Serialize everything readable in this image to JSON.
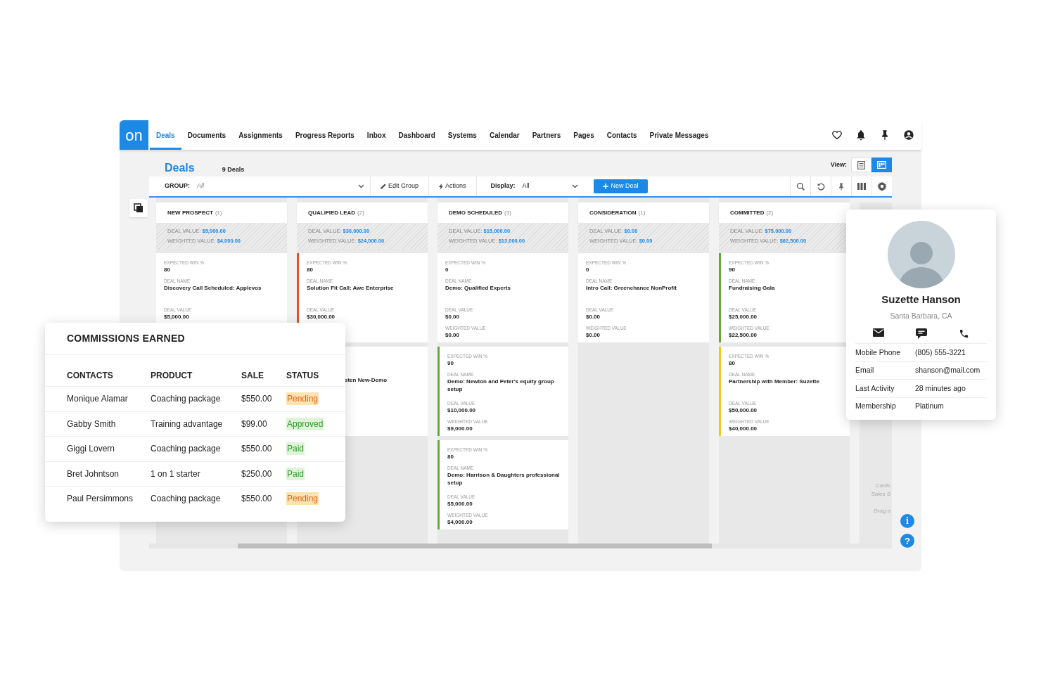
{
  "nav": {
    "logo": "on",
    "items": [
      {
        "label": "Deals",
        "selected": true
      },
      {
        "label": "Documents",
        "selected": false
      },
      {
        "label": "Assignments",
        "selected": false
      },
      {
        "label": "Progress Reports",
        "selected": false
      },
      {
        "label": "Inbox",
        "selected": false
      },
      {
        "label": "Dashboard",
        "selected": false
      },
      {
        "label": "Systems",
        "selected": false
      },
      {
        "label": "Calendar",
        "selected": false
      },
      {
        "label": "Partners",
        "selected": false
      },
      {
        "label": "Pages",
        "selected": false
      },
      {
        "label": "Contacts",
        "selected": false
      },
      {
        "label": "Private Messages",
        "selected": false
      }
    ]
  },
  "header": {
    "title": "Deals",
    "count": "9 Deals",
    "view_label": "View:",
    "views": [
      {
        "kind": "list",
        "selected": false
      },
      {
        "kind": "board",
        "selected": true
      }
    ]
  },
  "toolbar": {
    "group_label": "GROUP:",
    "group_placeholder": "All",
    "edit_group": "Edit Group",
    "actions": "Actions",
    "display_label": "Display:",
    "display_value": "All",
    "new_deal": "New Deal"
  },
  "columns": [
    {
      "title": "NEW PROSPECT",
      "count": "(1)",
      "deal_value_label": "DEAL VALUE:",
      "deal_value": "$5,000.00",
      "weighted_label": "WEIGHTED VALUE:",
      "weighted_value": "$4,000.00",
      "cards": [
        {
          "kind": "deal",
          "fields": [
            {
              "label": "EXPECTED WIN %",
              "value": "80"
            },
            {
              "label": "DEAL NAME",
              "value": "Discovery Call Scheduled: Applevos"
            },
            {
              "label": "DEAL VALUE",
              "value": "$5,000.00"
            }
          ]
        }
      ]
    },
    {
      "title": "QUALIFIED LEAD",
      "count": "(2)",
      "deal_value_label": "DEAL VALUE:",
      "deal_value": "$30,000.00",
      "weighted_label": "WEIGHTED VALUE:",
      "weighted_value": "$24,000.00",
      "cards": [
        {
          "kind": "deal",
          "color": "#e4521e",
          "fields": [
            {
              "label": "EXPECTED WIN %",
              "value": "80"
            },
            {
              "label": "DEAL NAME",
              "value": "Solution Fit Call: Awe Enterprise"
            },
            {
              "label": "DEAL VALUE",
              "value": "$30,000.00"
            }
          ]
        },
        {
          "kind": "covered",
          "fields": [
            {
              "value": "sten New-Demo"
            }
          ]
        }
      ]
    },
    {
      "title": "DEMO SCHEDULED",
      "count": "(3)",
      "deal_value_label": "DEAL VALUE:",
      "deal_value": "$15,000.00",
      "weighted_label": "WEIGHTED VALUE:",
      "weighted_value": "$13,000.00",
      "cards": [
        {
          "kind": "deal",
          "fields": [
            {
              "label": "EXPECTED WIN %",
              "value": "0"
            },
            {
              "label": "DEAL NAME",
              "value": "Demo: Qualified Experts"
            },
            {
              "label": "DEAL VALUE",
              "value": "$0.00"
            },
            {
              "label": "WEIGHTED VALUE",
              "value": "$0.00"
            }
          ]
        },
        {
          "kind": "deal",
          "color": "#65a83a",
          "fields": [
            {
              "label": "EXPECTED WIN %",
              "value": "90"
            },
            {
              "label": "DEAL NAME",
              "value": "Demo: Newton and Peter's equity group setup"
            },
            {
              "label": "DEAL VALUE",
              "value": "$10,000.00"
            },
            {
              "label": "WEIGHTED VALUE",
              "value": "$9,000.00"
            }
          ]
        },
        {
          "kind": "deal",
          "color": "#65a83a",
          "fields": [
            {
              "label": "EXPECTED WIN %",
              "value": "80"
            },
            {
              "label": "DEAL NAME",
              "value": "Demo: Harrison & Daughters professional setup"
            },
            {
              "label": "DEAL VALUE",
              "value": "$5,000.00"
            },
            {
              "label": "WEIGHTED VALUE",
              "value": "$4,000.00"
            }
          ]
        }
      ]
    },
    {
      "title": "CONSIDERATION",
      "count": "(1)",
      "deal_value_label": "DEAL VALUE:",
      "deal_value": "$0.00",
      "weighted_label": "WEIGHTED VALUE:",
      "weighted_value": "$0.00",
      "cards": [
        {
          "kind": "deal",
          "fields": [
            {
              "label": "EXPECTED WIN %",
              "value": "0"
            },
            {
              "label": "DEAL NAME",
              "value": "Intro Call: Greenchance NonProfit"
            },
            {
              "label": "DEAL VALUE",
              "value": "$0.00"
            },
            {
              "label": "WEIGHTED VALUE",
              "value": "$0.00"
            }
          ]
        }
      ]
    },
    {
      "title": "COMMITTED",
      "count": "(2)",
      "deal_value_label": "DEAL VALUE:",
      "deal_value": "$75,000.00",
      "weighted_label": "WEIGHTED VALUE:",
      "weighted_value": "$62,500.00",
      "cards": [
        {
          "kind": "deal",
          "color": "#65a83a",
          "fields": [
            {
              "label": "EXPECTED WIN %",
              "value": "90"
            },
            {
              "label": "DEAL NAME",
              "value": "Fundraising Gala"
            },
            {
              "label": "DEAL VALUE",
              "value": "$25,000.00"
            },
            {
              "label": "WEIGHTED VALUE",
              "value": "$22,500.00"
            }
          ]
        },
        {
          "kind": "deal",
          "color": "#f2c81c",
          "fields": [
            {
              "label": "EXPECTED WIN %",
              "value": "80"
            },
            {
              "label": "DEAL NAME",
              "value": "Partnership with Member: Suzette"
            },
            {
              "label": "DEAL VALUE",
              "value": "$50,000.00"
            },
            {
              "label": "WEIGHTED VALUE",
              "value": "$40,000.00"
            }
          ]
        }
      ]
    }
  ],
  "hidden_column_hints": [
    "Cards",
    "Sales S",
    "Drag a"
  ],
  "commissions": {
    "title": "COMMISSIONS EARNED",
    "columns": [
      "CONTACTS",
      "PRODUCT",
      "SALE",
      "STATUS"
    ],
    "rows": [
      {
        "contact": "Monique Alamar",
        "product": "Coaching package",
        "sale": "$550.00",
        "status": "Pending",
        "kind": "pending"
      },
      {
        "contact": "Gabby Smith",
        "product": "Training advantage",
        "sale": "$99.00",
        "status": "Approved",
        "kind": "approved"
      },
      {
        "contact": "Giggi Lovern",
        "product": "Coaching package",
        "sale": "$550.00",
        "status": "Paid",
        "kind": "paid"
      },
      {
        "contact": "Bret Johntson",
        "product": "1 on 1 starter",
        "sale": "$250.00",
        "status": "Paid",
        "kind": "paid"
      },
      {
        "contact": "Paul Persimmons",
        "product": "Coaching package",
        "sale": "$550.00",
        "status": "Pending",
        "kind": "pending"
      }
    ]
  },
  "contact_card": {
    "name": "Suzette Hanson",
    "location": "Santa Barbara, CA",
    "details": [
      {
        "label": "Mobile Phone",
        "value": "(805) 555-3221"
      },
      {
        "label": "Email",
        "value": "shanson@mail.com"
      },
      {
        "label": "Last Activity",
        "value": "28 minutes ago"
      },
      {
        "label": "Membership",
        "value": "Platinum"
      }
    ]
  },
  "corner_buttons": [
    {
      "kind": "info",
      "glyph": "i"
    },
    {
      "kind": "help",
      "glyph": "?"
    }
  ]
}
